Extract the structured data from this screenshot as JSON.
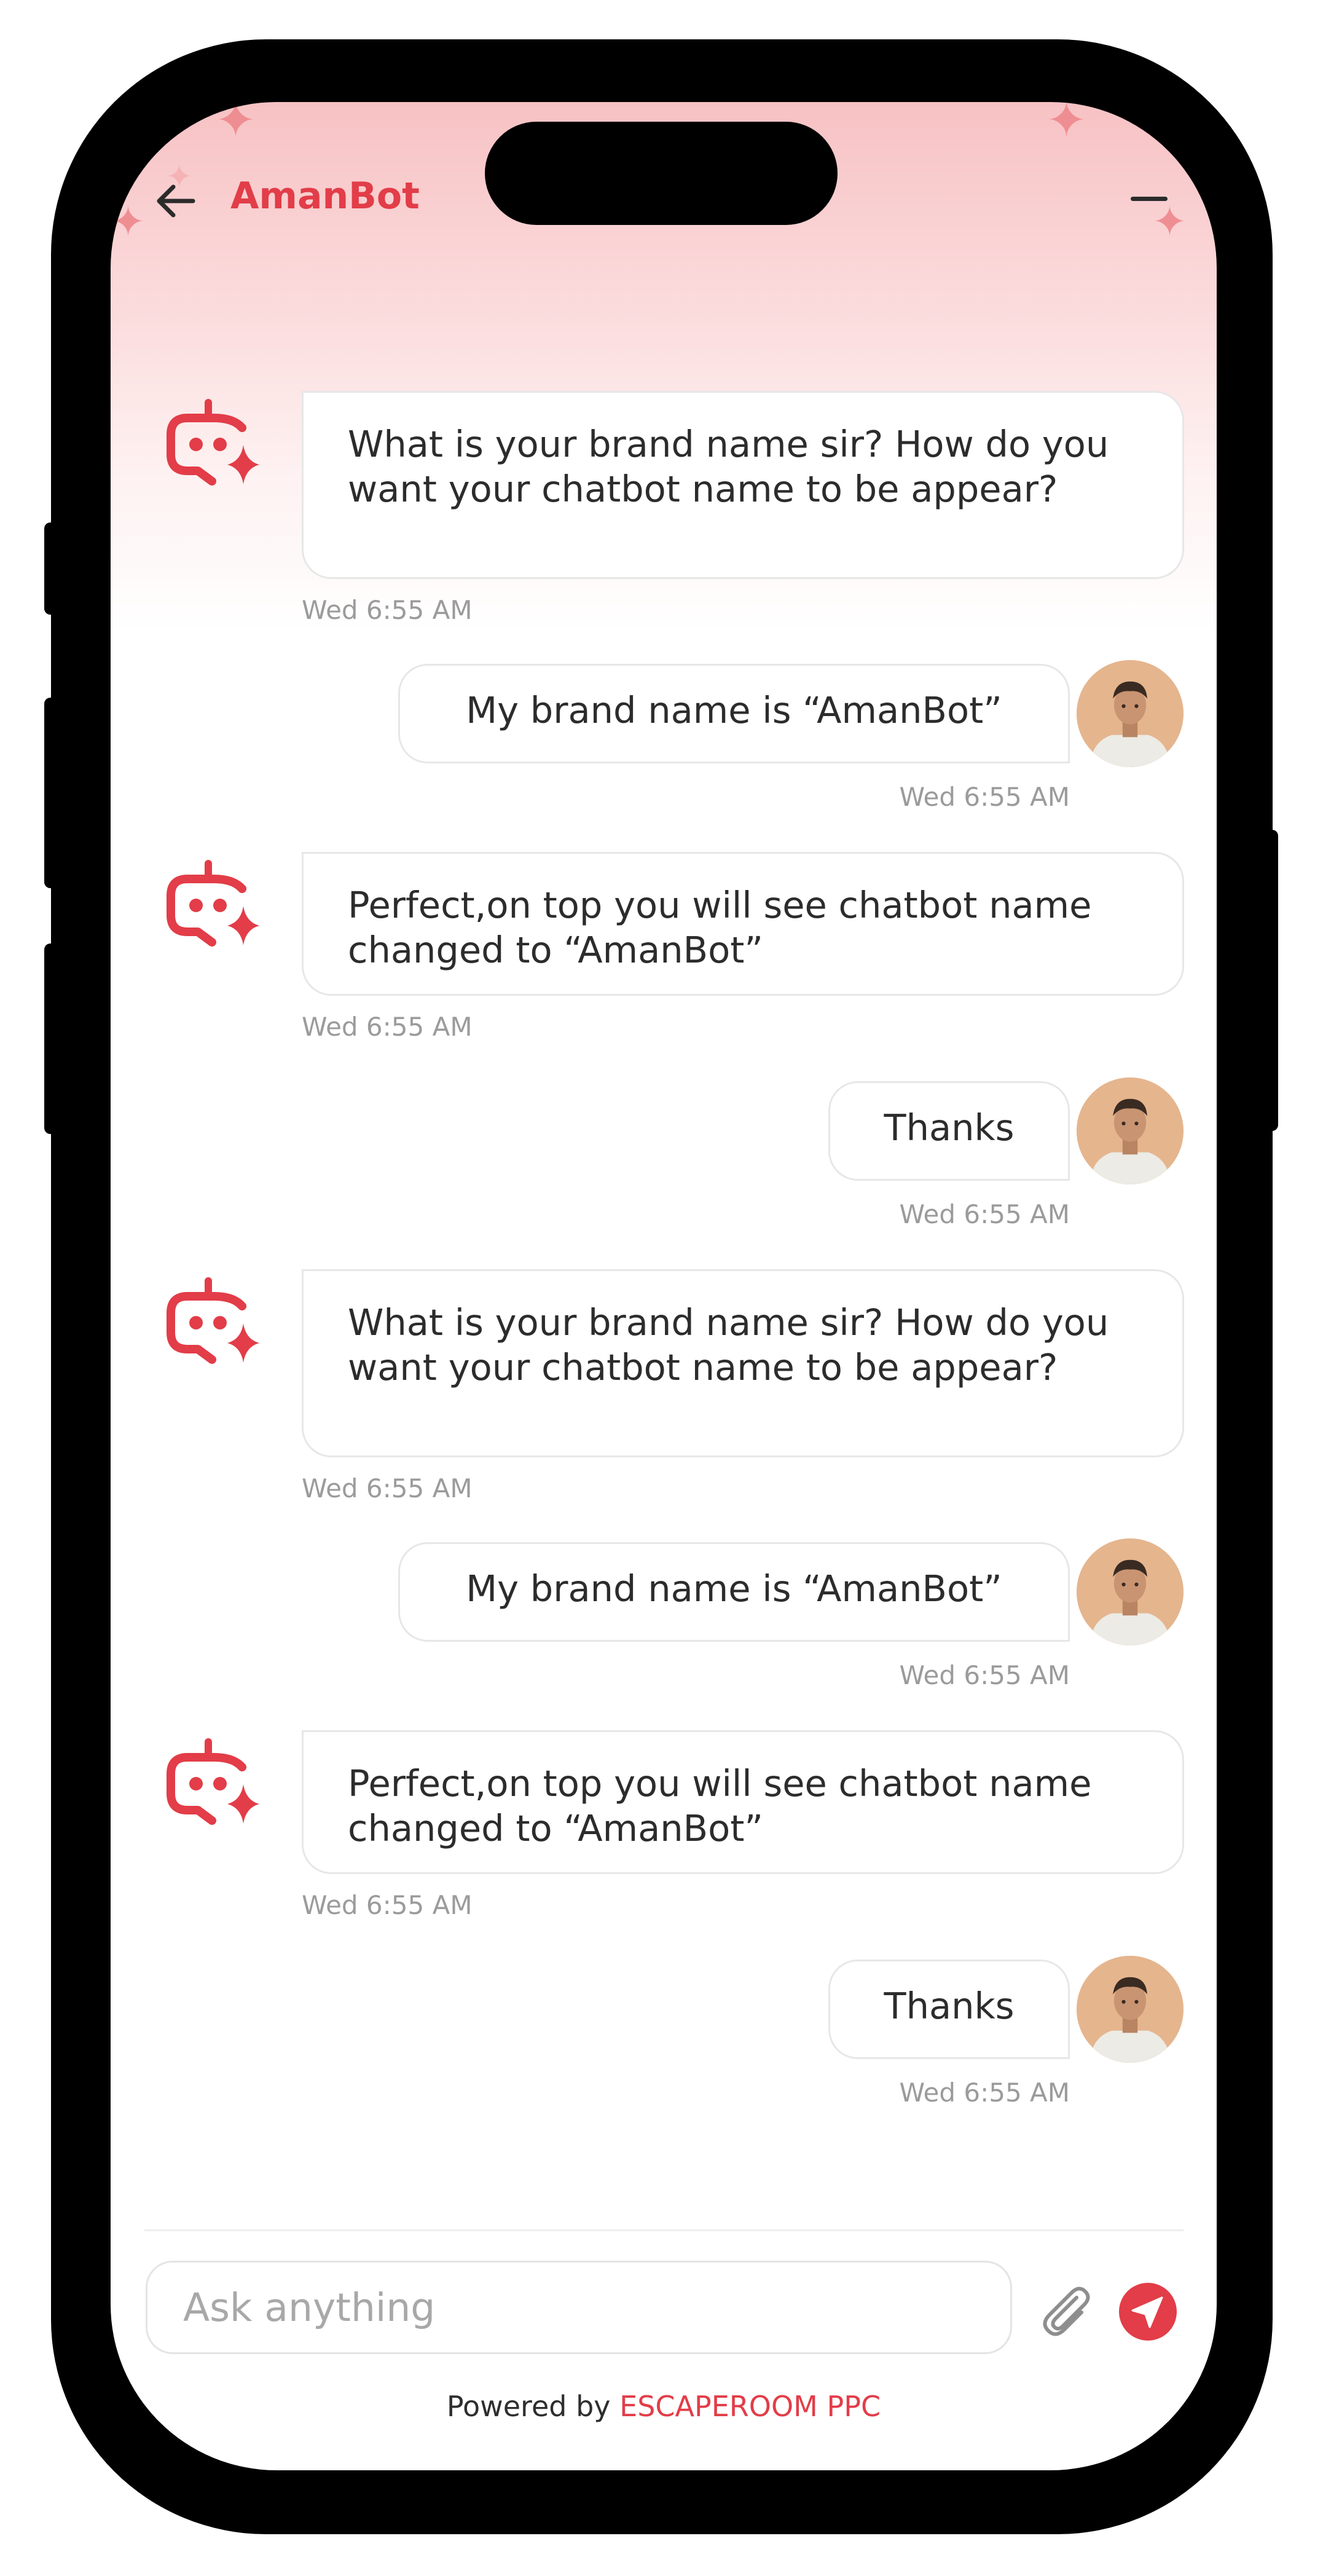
{
  "header": {
    "title": "AmanBot"
  },
  "colors": {
    "accent": "#e23d48",
    "sparkle": "#ef8e92"
  },
  "icons": {
    "back": "arrow-left-icon",
    "minimize": "minus-icon",
    "bot": "chatbot-sparkle-icon",
    "attach": "paperclip-icon",
    "send": "paper-plane-icon"
  },
  "messages": [
    {
      "sender": "bot",
      "text": "What is your brand name sir? How do you want your chatbot name to be appear?",
      "time": "Wed 6:55 AM"
    },
    {
      "sender": "user",
      "text": "My brand name is “AmanBot”",
      "time": "Wed 6:55 AM"
    },
    {
      "sender": "bot",
      "text": "Perfect,on top you will see chatbot name changed to “AmanBot”",
      "time": "Wed 6:55 AM"
    },
    {
      "sender": "user",
      "text": "Thanks",
      "time": "Wed 6:55 AM"
    },
    {
      "sender": "bot",
      "text": "What is your brand name sir? How do you want your chatbot name to be appear?",
      "time": "Wed 6:55 AM"
    },
    {
      "sender": "user",
      "text": "My brand name is “AmanBot”",
      "time": "Wed 6:55 AM"
    },
    {
      "sender": "bot",
      "text": "Perfect,on top you will see chatbot name changed to “AmanBot”",
      "time": "Wed 6:55 AM"
    },
    {
      "sender": "user",
      "text": "Thanks",
      "time": "Wed 6:55 AM"
    }
  ],
  "composer": {
    "placeholder": "Ask anything"
  },
  "footer": {
    "prefix": "Powered by",
    "brand": "ESCAPEROOM PPC"
  }
}
